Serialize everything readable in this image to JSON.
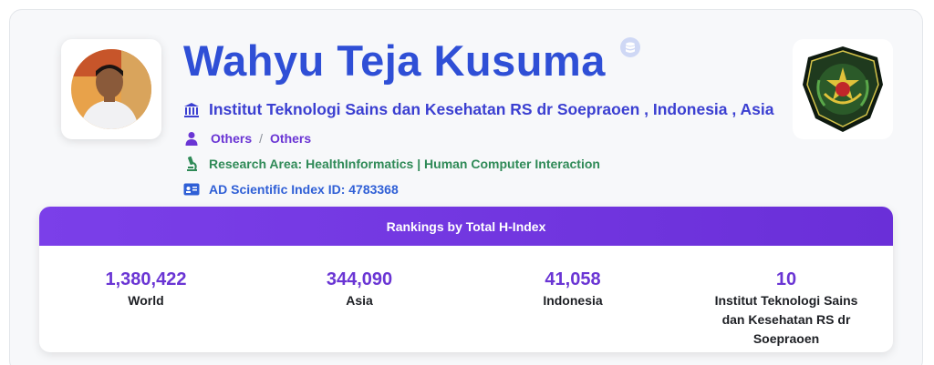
{
  "profile": {
    "name": "Wahyu Teja Kusuma",
    "institution": "Institut Teknologi Sains dan Kesehatan RS dr Soepraoen , Indonesia , Asia",
    "field_primary": "Others",
    "field_separator": "/",
    "field_secondary": "Others",
    "research_area": "Research Area: HealthInformatics | Human Computer Interaction",
    "scientific_id": "AD Scientific Index ID: 4783368"
  },
  "rankings": {
    "title": "Rankings by Total H-Index",
    "items": [
      {
        "value": "1,380,422",
        "label": "World"
      },
      {
        "value": "344,090",
        "label": "Asia"
      },
      {
        "value": "41,058",
        "label": "Indonesia"
      },
      {
        "value": "10",
        "label": "Institut Teknologi Sains dan Kesehatan RS dr Soepraoen"
      }
    ]
  },
  "colors": {
    "name": "#2f4fd6",
    "institution": "#3b3fd1",
    "fields": "#6a35d4",
    "research": "#2f8a57",
    "scientific_id": "#2f5fd6",
    "header_gradient_start": "#7b3fe9",
    "header_gradient_end": "#6a2fd8"
  },
  "icons": {
    "name_badge": "database-icon",
    "institution": "bank-icon",
    "fields": "user-icon",
    "research": "microscope-icon",
    "scientific_id": "id-card-icon"
  }
}
